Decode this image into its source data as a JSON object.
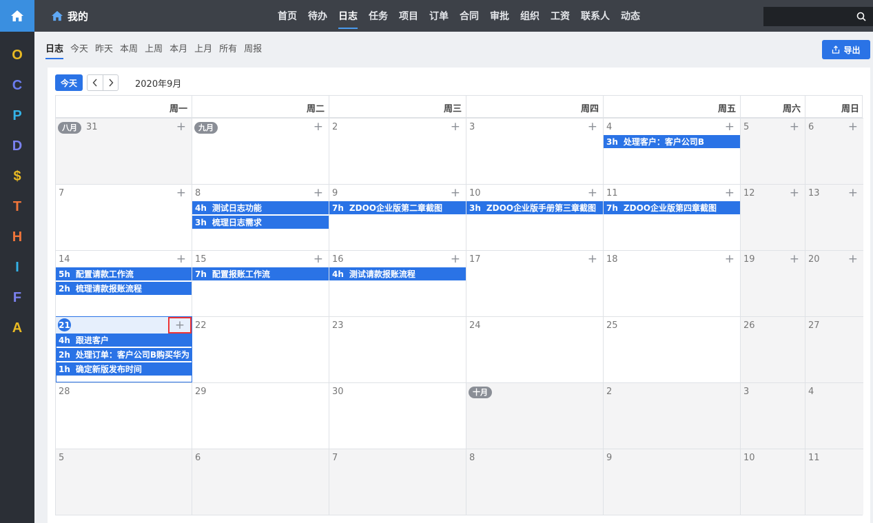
{
  "appbar": {
    "letters": [
      {
        "char": "O",
        "color": "#e8b923"
      },
      {
        "char": "C",
        "color": "#6a7cf0"
      },
      {
        "char": "P",
        "color": "#34b3e8"
      },
      {
        "char": "D",
        "color": "#7b82f0"
      },
      {
        "char": "$",
        "color": "#e8b923"
      },
      {
        "char": "T",
        "color": "#f0753a"
      },
      {
        "char": "H",
        "color": "#f0753a"
      },
      {
        "char": "I",
        "color": "#34b3e8"
      },
      {
        "char": "F",
        "color": "#7b82f0"
      },
      {
        "char": "A",
        "color": "#e8b923"
      }
    ]
  },
  "navbar": {
    "brand": "我的",
    "menu": [
      "首页",
      "待办",
      "日志",
      "任务",
      "项目",
      "订单",
      "合同",
      "审批",
      "组织",
      "工资",
      "联系人",
      "动态"
    ],
    "active_menu": "日志"
  },
  "subnav": {
    "tabs": [
      "日志",
      "今天",
      "昨天",
      "本周",
      "上周",
      "本月",
      "上月",
      "所有",
      "周报"
    ],
    "active_tab": "日志",
    "export_label": "导出"
  },
  "toolbar": {
    "today_label": "今天",
    "month_title": "2020年9月"
  },
  "calendar": {
    "weekdays": [
      "周一",
      "周二",
      "周三",
      "周四",
      "周五",
      "周六",
      "周日"
    ],
    "weeks": [
      [
        {
          "num": "31",
          "month_badge": "八月",
          "other": true,
          "add": true
        },
        {
          "num": "",
          "month_badge": "九月",
          "add": true
        },
        {
          "num": "2",
          "add": true
        },
        {
          "num": "3",
          "add": true
        },
        {
          "num": "4",
          "add": true,
          "events": [
            {
              "hours": "3h",
              "title": "处理客户：客户公司B"
            }
          ]
        },
        {
          "num": "5",
          "weekend": true,
          "add": true
        },
        {
          "num": "6",
          "weekend": true,
          "add": true
        }
      ],
      [
        {
          "num": "7",
          "add": true
        },
        {
          "num": "8",
          "add": true,
          "events": [
            {
              "hours": "4h",
              "title": "测试日志功能"
            },
            {
              "hours": "3h",
              "title": "梳理日志需求"
            }
          ]
        },
        {
          "num": "9",
          "add": true,
          "events": [
            {
              "hours": "7h",
              "title": "ZDOO企业版第二章截图"
            }
          ]
        },
        {
          "num": "10",
          "add": true,
          "events": [
            {
              "hours": "3h",
              "title": "ZDOO企业版手册第三章截图"
            }
          ]
        },
        {
          "num": "11",
          "add": true,
          "events": [
            {
              "hours": "7h",
              "title": "ZDOO企业版第四章截图"
            }
          ]
        },
        {
          "num": "12",
          "weekend": true,
          "add": true
        },
        {
          "num": "13",
          "weekend": true,
          "add": true
        }
      ],
      [
        {
          "num": "14",
          "add": true,
          "events": [
            {
              "hours": "5h",
              "title": "配置请款工作流"
            },
            {
              "hours": "2h",
              "title": "梳理请款报账流程"
            }
          ]
        },
        {
          "num": "15",
          "add": true,
          "events": [
            {
              "hours": "7h",
              "title": "配置报账工作流"
            }
          ]
        },
        {
          "num": "16",
          "add": true,
          "events": [
            {
              "hours": "4h",
              "title": "测试请款报账流程"
            }
          ]
        },
        {
          "num": "17",
          "add": true
        },
        {
          "num": "18",
          "add": true
        },
        {
          "num": "19",
          "weekend": true,
          "add": true
        },
        {
          "num": "20",
          "weekend": true,
          "add": true
        }
      ],
      [
        {
          "num": "21",
          "today": true,
          "add": true,
          "events": [
            {
              "hours": "4h",
              "title": "跟进客户"
            },
            {
              "hours": "2h",
              "title": "处理订单：客户公司B购买华为"
            },
            {
              "hours": "1h",
              "title": "确定新版发布时间"
            }
          ]
        },
        {
          "num": "22"
        },
        {
          "num": "23"
        },
        {
          "num": "24"
        },
        {
          "num": "25"
        },
        {
          "num": "26",
          "weekend": true
        },
        {
          "num": "27",
          "weekend": true
        }
      ],
      [
        {
          "num": "28"
        },
        {
          "num": "29"
        },
        {
          "num": "30"
        },
        {
          "num": "",
          "month_badge": "十月",
          "other": true
        },
        {
          "num": "2",
          "other": true
        },
        {
          "num": "3",
          "other": true
        },
        {
          "num": "4",
          "other": true
        }
      ],
      [
        {
          "num": "5",
          "other": true
        },
        {
          "num": "6",
          "other": true
        },
        {
          "num": "7",
          "other": true
        },
        {
          "num": "8",
          "other": true
        },
        {
          "num": "9",
          "other": true
        },
        {
          "num": "10",
          "other": true
        },
        {
          "num": "11",
          "other": true
        }
      ]
    ]
  },
  "colors": {
    "accent": "#2a73e6",
    "navbar": "#3d4148",
    "appbar": "#2b2f36",
    "highlight": "#e33333"
  }
}
